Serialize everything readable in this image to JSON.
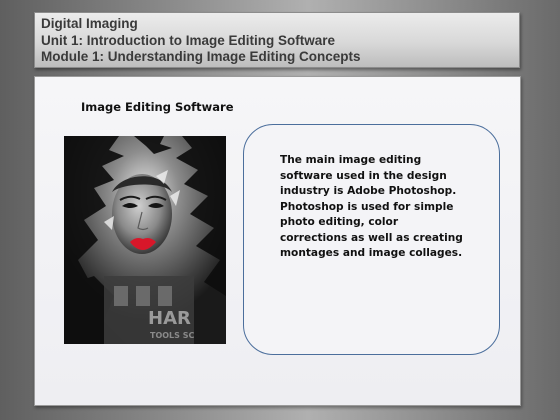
{
  "header": {
    "course": "Digital Imaging",
    "unit": "Unit 1: Introduction to Image Editing Software",
    "module": "Module 1: Understanding Image Editing Concepts"
  },
  "main": {
    "section_title": "Image Editing Software",
    "image": {
      "description": "montage",
      "overlay_text": "HAR",
      "overlay_subtext": "TOOLS SC"
    },
    "callout_lines": [
      "The main image editing",
      "software used in the design",
      "industry is Adobe Photoshop.",
      "Photoshop is used for simple",
      "photo editing, color",
      "corrections as well as creating",
      "montages and image collages."
    ]
  },
  "colors": {
    "header_text": "#3a3a3a",
    "callout_border": "#4b6e9c",
    "lips": "#d8172a"
  }
}
